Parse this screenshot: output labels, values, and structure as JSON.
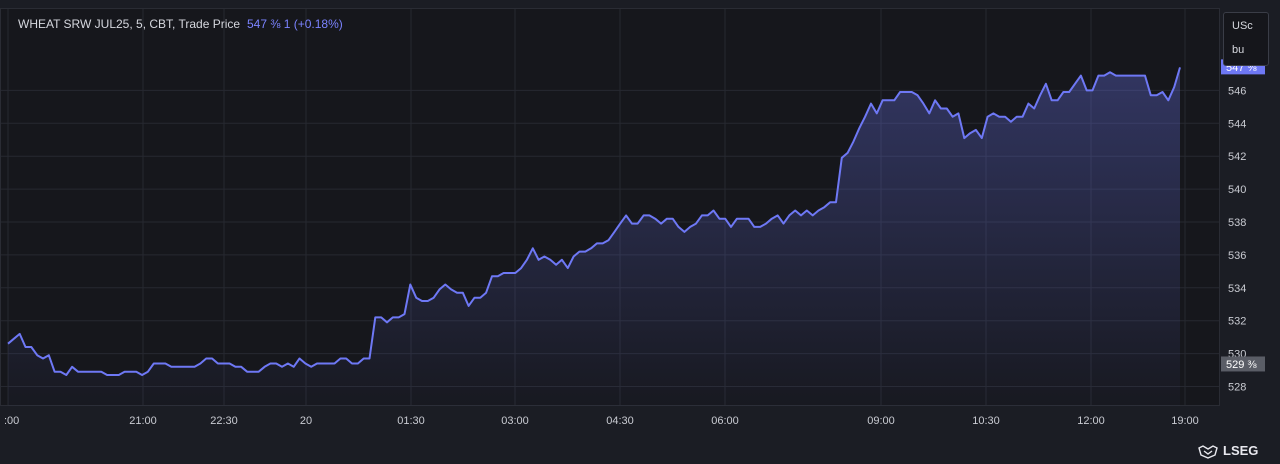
{
  "header": {
    "title": "WHEAT SRW JUL25, 5, CBT, Trade Price",
    "price_change": "547 ⅜  1 (+0.18%)"
  },
  "unit": {
    "line1": "USc",
    "line2": "bu"
  },
  "brand": {
    "name": "LSEG"
  },
  "markers": {
    "last": "547 ⅜",
    "previous": "529 ⅜"
  },
  "colors": {
    "line": "#6e78f5",
    "background": "#16171c",
    "last_marker": "#6e78f5",
    "prev_marker": "#5a5d66"
  },
  "chart_data": {
    "type": "area",
    "title": "WHEAT SRW JUL25, 5, CBT, Trade Price",
    "xlabel": "",
    "ylabel": "",
    "x_tick_labels": [
      ":00",
      "21:00",
      "22:30",
      "20",
      "01:30",
      "03:00",
      "04:30",
      "06:00",
      "09:00",
      "10:30",
      "12:00",
      "19:00"
    ],
    "y_tick_labels": [
      "528",
      "530",
      "532",
      "534",
      "536",
      "538",
      "540",
      "542",
      "544",
      "546"
    ],
    "ylim": [
      527,
      548
    ],
    "grid": true,
    "series": [
      {
        "values": [
          530.6,
          530.9,
          531.2,
          530.4,
          530.4,
          529.9,
          529.7,
          529.9,
          528.9,
          528.9,
          528.7,
          529.2,
          528.9,
          528.9,
          528.9,
          528.9,
          528.9,
          528.7,
          528.7,
          528.7,
          528.9,
          528.9,
          528.9,
          528.7,
          528.9,
          529.4,
          529.4,
          529.4,
          529.2,
          529.2,
          529.2,
          529.2,
          529.2,
          529.4,
          529.7,
          529.7,
          529.4,
          529.4,
          529.4,
          529.2,
          529.2,
          528.9,
          528.9,
          528.9,
          529.2,
          529.4,
          529.4,
          529.2,
          529.4,
          529.2,
          529.7,
          529.4,
          529.2,
          529.4,
          529.4,
          529.4,
          529.4,
          529.7,
          529.7,
          529.4,
          529.4,
          529.7,
          529.7,
          532.2,
          532.2,
          531.9,
          532.2,
          532.2,
          532.4,
          534.2,
          533.4,
          533.2,
          533.2,
          533.4,
          533.9,
          534.2,
          533.9,
          533.7,
          533.7,
          532.9,
          533.4,
          533.4,
          533.7,
          534.7,
          534.7,
          534.9,
          534.9,
          534.9,
          535.2,
          535.7,
          536.4,
          535.7,
          535.9,
          535.7,
          535.4,
          535.7,
          535.2,
          535.9,
          536.2,
          536.2,
          536.4,
          536.7,
          536.7,
          536.9,
          537.4,
          537.9,
          538.4,
          537.9,
          537.9,
          538.4,
          538.4,
          538.2,
          537.9,
          538.2,
          538.2,
          537.7,
          537.4,
          537.7,
          537.9,
          538.4,
          538.4,
          538.7,
          538.2,
          538.2,
          537.7,
          538.2,
          538.2,
          538.2,
          537.7,
          537.7,
          537.9,
          538.2,
          538.4,
          537.9,
          538.4,
          538.7,
          538.4,
          538.7,
          538.4,
          538.7,
          538.9,
          539.2,
          539.2,
          541.9,
          542.2,
          542.9,
          543.7,
          544.4,
          545.2,
          544.6,
          545.4,
          545.4,
          545.4,
          545.9,
          545.9,
          545.9,
          545.7,
          545.2,
          544.6,
          545.4,
          544.9,
          544.9,
          544.4,
          544.6,
          543.1,
          543.4,
          543.6,
          543.1,
          544.4,
          544.6,
          544.4,
          544.4,
          544.1,
          544.4,
          544.4,
          545.2,
          544.9,
          545.7,
          546.4,
          545.4,
          545.4,
          545.9,
          545.9,
          546.4,
          546.9,
          546.0,
          546.0,
          546.9,
          546.9,
          547.1,
          546.9,
          546.9,
          546.9,
          546.9,
          546.9,
          546.9,
          545.7,
          545.7,
          545.9,
          545.4,
          546.2,
          547.4
        ]
      }
    ],
    "last_value": "547 ⅜",
    "previous_close": "529 ⅜"
  }
}
